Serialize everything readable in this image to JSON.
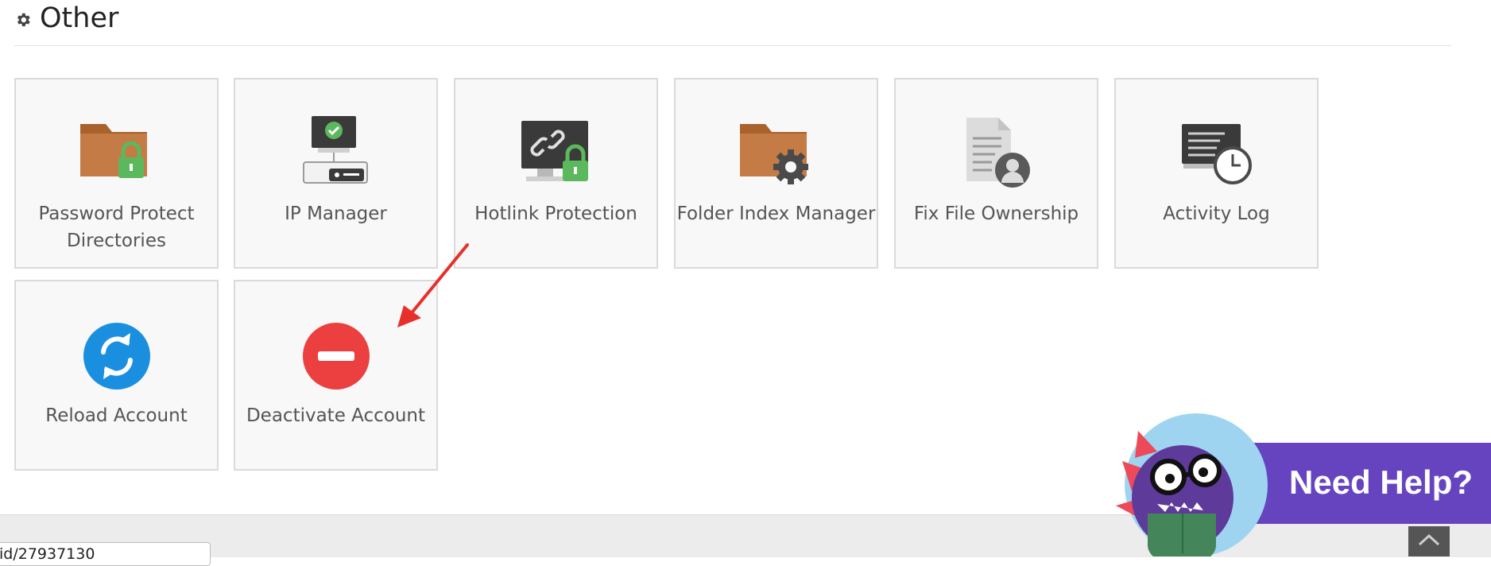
{
  "section": {
    "title": "Other"
  },
  "tiles": [
    {
      "label": "Password Protect Directories",
      "icon": "folder-lock-icon"
    },
    {
      "label": "IP Manager",
      "icon": "ip-manager-icon"
    },
    {
      "label": "Hotlink Protection",
      "icon": "hotlink-protection-icon"
    },
    {
      "label": "Folder Index Manager",
      "icon": "folder-gear-icon"
    },
    {
      "label": "Fix File Ownership",
      "icon": "file-user-icon"
    },
    {
      "label": "Activity Log",
      "icon": "activity-log-icon"
    },
    {
      "label": "Reload Account",
      "icon": "reload-icon"
    },
    {
      "label": "Deactivate Account",
      "icon": "minus-circle-icon"
    }
  ],
  "help": {
    "label": "Need Help?"
  },
  "footer": {
    "url_fragment": "id/27937130"
  },
  "colors": {
    "help_banner": "#6644c0",
    "reload_blue": "#1a8fe0",
    "deactivate_red": "#ec3f3f",
    "arrow_red": "#e8302b",
    "lock_green": "#5cb85c",
    "folder_brown": "#c47b45"
  }
}
